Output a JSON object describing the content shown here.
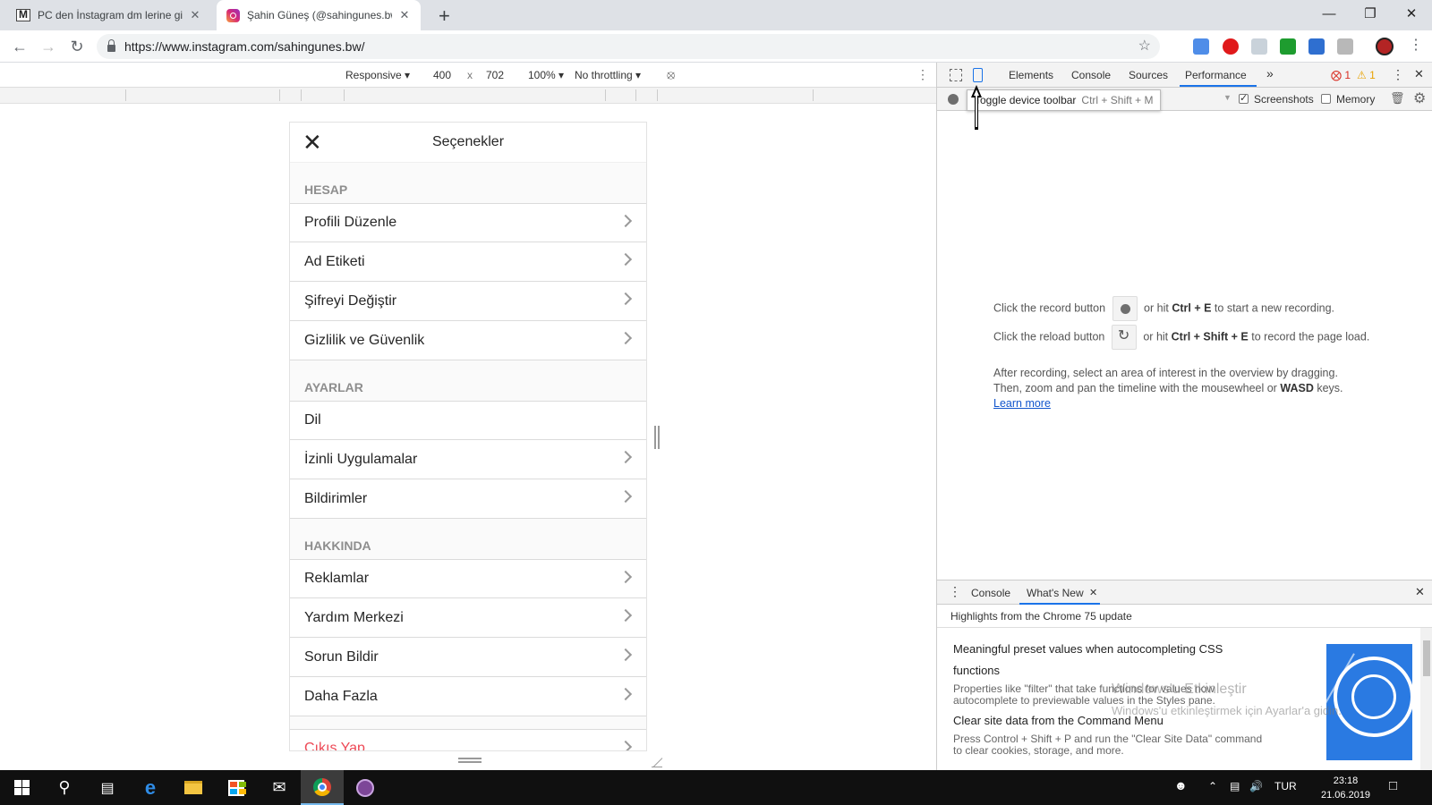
{
  "browser": {
    "tabs": [
      {
        "title": "PC den İnstagram dm lerine girm",
        "icon": "gmail-icon"
      },
      {
        "title": "Şahin Güneş (@sahingunes.bw) ·",
        "icon": "instagram-icon"
      }
    ],
    "url": "https://www.instagram.com/sahingunes.bw/"
  },
  "device_toolbar": {
    "mode": "Responsive",
    "width": "400",
    "times": "x",
    "height": "702",
    "zoom": "100%",
    "throttling": "No throttling"
  },
  "phone": {
    "title": "Seçenekler",
    "close": "✕",
    "sections": [
      {
        "header": "HESAP",
        "items": [
          "Profili Düzenle",
          "Ad Etiketi",
          "Şifreyi Değiştir",
          "Gizlilik ve Güvenlik"
        ]
      },
      {
        "header": "AYARLAR",
        "items": [
          "Dil",
          "İzinli Uygulamalar",
          "Bildirimler"
        ]
      },
      {
        "header": "HAKKINDA",
        "items": [
          "Reklamlar",
          "Yardım Merkezi",
          "Sorun Bildir",
          "Daha Fazla"
        ]
      }
    ],
    "logout": "Çıkış Yap"
  },
  "devtools": {
    "tabs": [
      "Elements",
      "Console",
      "Sources",
      "Performance"
    ],
    "more": "»",
    "errors": "1",
    "warnings": "1",
    "tooltip": {
      "label": "Toggle device toolbar",
      "shortcut": "Ctrl + Shift + M"
    },
    "screenshots_label": "Screenshots",
    "memory_label": "Memory",
    "record_line": {
      "pre": "Click the record button",
      "mid": "or hit",
      "key": "Ctrl + E",
      "post": "to start a new recording."
    },
    "reload_line": {
      "pre": "Click the reload button",
      "mid": "or hit",
      "key": "Ctrl + Shift + E",
      "post": "to record the page load."
    },
    "after_line1": "After recording, select an area of interest in the overview by dragging.",
    "after_line2_pre": "Then, zoom and pan the timeline with the mousewheel or",
    "after_line2_key": "WASD",
    "after_line2_post": "keys.",
    "learn_more": "Learn more"
  },
  "drawer": {
    "tabs": [
      "Console",
      "What's New"
    ],
    "header": "Highlights from the Chrome 75 update",
    "items": [
      {
        "title1": "Meaningful preset values when autocompleting CSS",
        "title2": "functions",
        "desc1": "Properties like \"filter\" that take functions for values now",
        "desc2": "autocomplete to previewable values in the Styles pane."
      },
      {
        "title1": "Clear site data from the Command Menu",
        "desc1": "Press Control + Shift + P and run the \"Clear Site Data\" command",
        "desc2": "to clear cookies, storage, and more."
      }
    ],
    "watermark1": "Windows'u Etkinleştir",
    "watermark2": "Windows'u etkinleştirmek için Ayarlar'a gidin."
  },
  "taskbar": {
    "lang": "TUR",
    "time": "23:18",
    "date": "21.06.2019"
  }
}
